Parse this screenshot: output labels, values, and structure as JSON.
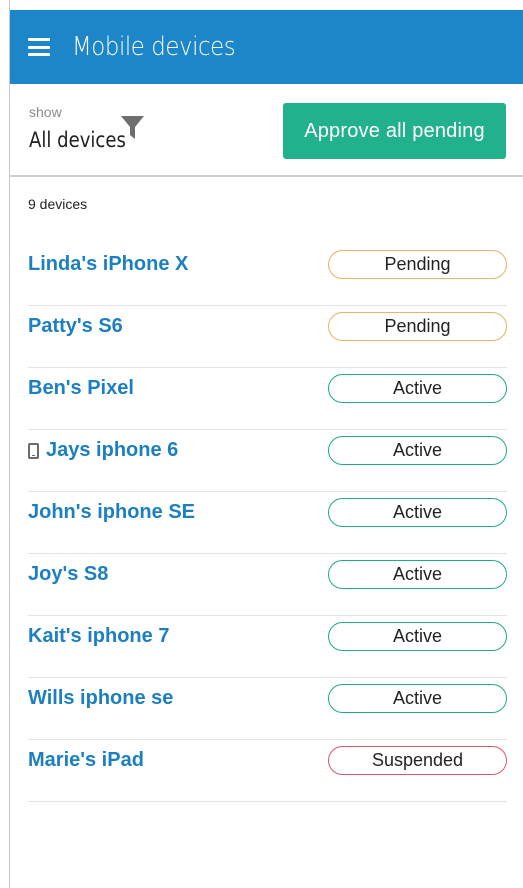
{
  "header": {
    "title": "Mobile devices",
    "menu_icon": "hamburger-menu-icon"
  },
  "filter": {
    "label": "show",
    "value": "All devices",
    "icon": "funnel-icon"
  },
  "actions": {
    "approve_label": "Approve all pending"
  },
  "summary": {
    "count_text": "9 devices"
  },
  "devices": [
    {
      "name": "Linda's iPhone X",
      "status": "Pending"
    },
    {
      "name": "Patty's S6",
      "status": "Pending"
    },
    {
      "name": "Ben's Pixel",
      "status": "Active"
    },
    {
      "name": "Jays iphone 6",
      "status": "Active",
      "icon": "mobile-phone-icon"
    },
    {
      "name": "John's iphone SE",
      "status": "Active"
    },
    {
      "name": "Joy's S8",
      "status": "Active"
    },
    {
      "name": "Kait's iphone 7",
      "status": "Active"
    },
    {
      "name": "Wills iphone se",
      "status": "Active"
    },
    {
      "name": "Marie's iPad",
      "status": "Suspended"
    }
  ],
  "colors": {
    "header": "#1d86c9",
    "approve": "#21b18d",
    "link": "#1b7fc0",
    "active": "#1fab8a",
    "pending": "#e9b463",
    "suspended": "#e0536b"
  }
}
